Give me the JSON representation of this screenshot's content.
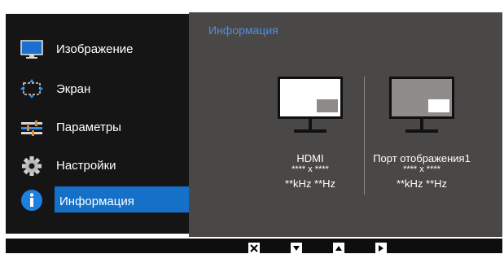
{
  "menu": {
    "items": [
      {
        "label": "Изображение",
        "icon": "monitor-icon"
      },
      {
        "label": "Экран",
        "icon": "screen-resize-icon"
      },
      {
        "label": "Параметры",
        "icon": "sliders-icon"
      },
      {
        "label": "Настройки",
        "icon": "gear-icon"
      },
      {
        "label": "Информация",
        "icon": "info-icon",
        "active": true
      }
    ]
  },
  "panel": {
    "title": "Информация",
    "sources": [
      {
        "name": "HDMI",
        "resolution": "**** x ****",
        "frequency": "**kHz **Hz",
        "highlight": "gray"
      },
      {
        "name": "Порт отображения1",
        "resolution": "**** x ****",
        "frequency": "**kHz **Hz",
        "highlight": "white"
      }
    ]
  },
  "bottom_bar": {
    "buttons": [
      "close-icon",
      "arrow-down-icon",
      "arrow-up-icon",
      "arrow-right-icon"
    ]
  },
  "colors": {
    "accent": "#1570c8",
    "title": "#4d8fe0",
    "panel_bg": "#4a4847",
    "menu_bg": "#151515"
  }
}
